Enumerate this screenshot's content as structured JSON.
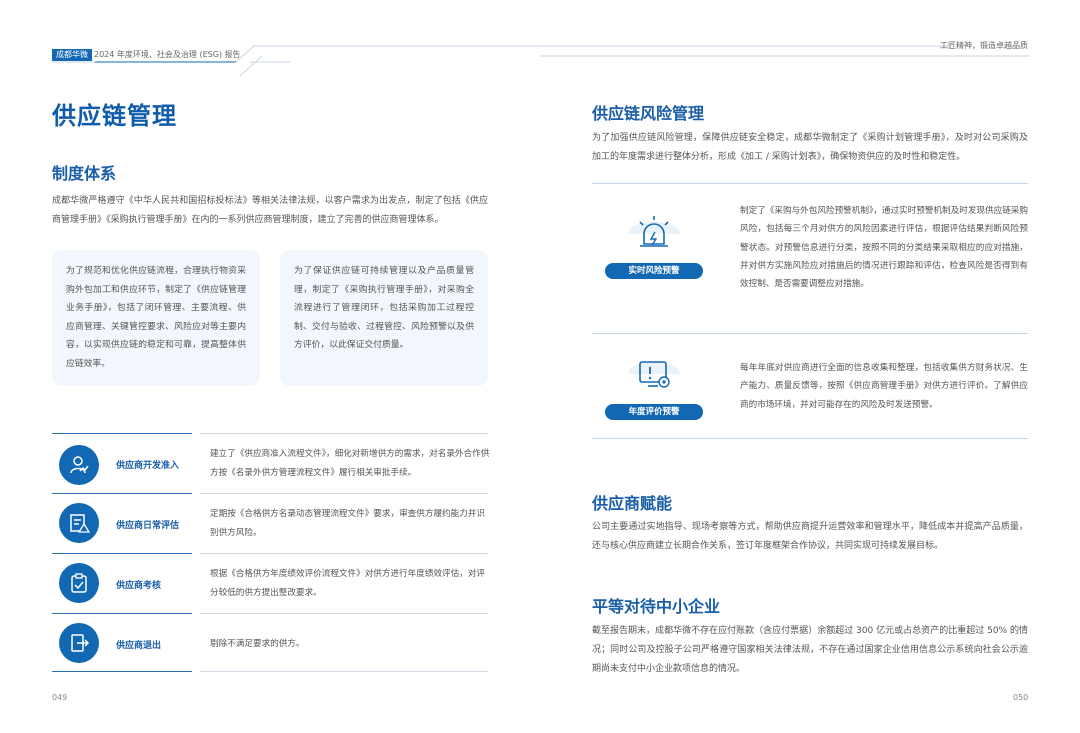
{
  "header": {
    "brand": "成都华微",
    "report_title": "2024 年度环境、社会及治理 (ESG) 报告",
    "slogan": "工匠精神，锻造卓越品质"
  },
  "left": {
    "title": "供应链管理",
    "system": {
      "heading": "制度体系",
      "intro": "成都华微严格遵守《中华人民共和国招标投标法》等相关法律法规，以客户需求为出发点，制定了包括《供应商管理手册》《采购执行管理手册》在内的一系列供应商管理制度，建立了完善的供应商管理体系。",
      "card1": "为了规范和优化供应链流程，合理执行物资采购外包加工和供应环节，制定了《供应链管理业务手册》，包括了闭环管理、主要流程、供应商管理、关键管控要求、风险应对等主要内容，以实现供应链的稳定和可靠，提高整体供应链效率。",
      "card2": "为了保证供应链可持续管理以及产品质量管理，制定了《采购执行管理手册》，对采购全流程进行了管理闭环，包括采购加工过程控制、交付与验收、过程管控、风险预警以及供方评价，以此保证交付质量。"
    },
    "rows": [
      {
        "icon": "user-check-icon",
        "label": "供应商开发准入",
        "desc": "建立了《供应商准入流程文件》，细化对新增供方的需求，对名录外合作供方按《名录外供方管理流程文件》履行相关审批手续。"
      },
      {
        "icon": "document-warning-icon",
        "label": "供应商日常评估",
        "desc": "定期按《合格供方名录动态管理流程文件》要求，审查供方履约能力并识别供方风险。"
      },
      {
        "icon": "clipboard-check-icon",
        "label": "供应商考核",
        "desc": "根据《合格供方年度绩效评价流程文件》对供方进行年度绩效评估，对评分较低的供方提出整改要求。"
      },
      {
        "icon": "exit-icon",
        "label": "供应商退出",
        "desc": "剔除不满足要求的供方。"
      }
    ],
    "page_number": "049"
  },
  "right": {
    "risk": {
      "heading": "供应链风险管理",
      "intro": "为了加强供应链风险管理，保障供应链安全稳定，成都华微制定了《采购计划管理手册》，及时对公司采购及加工的年度需求进行整体分析，形成《加工 / 采购计划表》，确保物资供应的及时性和稳定性。",
      "items": [
        {
          "icon": "alarm-icon",
          "badge": "实时风险预警",
          "desc": "制定了《采购与外包风险预警机制》，通过实时预警机制及时发现供应链采购风险，包括每三个月对供方的风险因素进行评估，根据评估结果判断风险预警状态。对预警信息进行分类，按照不同的分类结果采取相应的应对措施，并对供方实施风险应对措施后的情况进行跟踪和评估，检查风险是否得到有效控制、是否需要调整应对措施。"
        },
        {
          "icon": "monitor-alert-icon",
          "badge": "年度评价预警",
          "desc": "每年年底对供应商进行全面的信息收集和整理，包括收集供方财务状况、生产能力、质量反馈等，按照《供应商管理手册》对供方进行评价。了解供应商的市场环境，并对可能存在的风险及时发送预警。"
        }
      ]
    },
    "empower": {
      "heading": "供应商赋能",
      "text": "公司主要通过实地指导、现场考察等方式，帮助供应商提升运营效率和管理水平，降低成本并提高产品质量，还与核心供应商建立长期合作关系，签订年度框架合作协议，共同实现可持续发展目标。"
    },
    "sme": {
      "heading": "平等对待中小企业",
      "text": "截至报告期末，成都华微不存在应付账款（含应付票据）余额超过 300 亿元或占总资产的比重超过 50% 的情况；同时公司及控股子公司严格遵守国家相关法律法规，不存在通过国家企业信用信息公示系统向社会公示逾期尚未支付中小企业款项信息的情况。"
    },
    "page_number": "050"
  },
  "colors": {
    "brand_blue": "#1368b4",
    "heading_blue": "#1a5ea8",
    "card_bg": "#f1f7fc"
  }
}
